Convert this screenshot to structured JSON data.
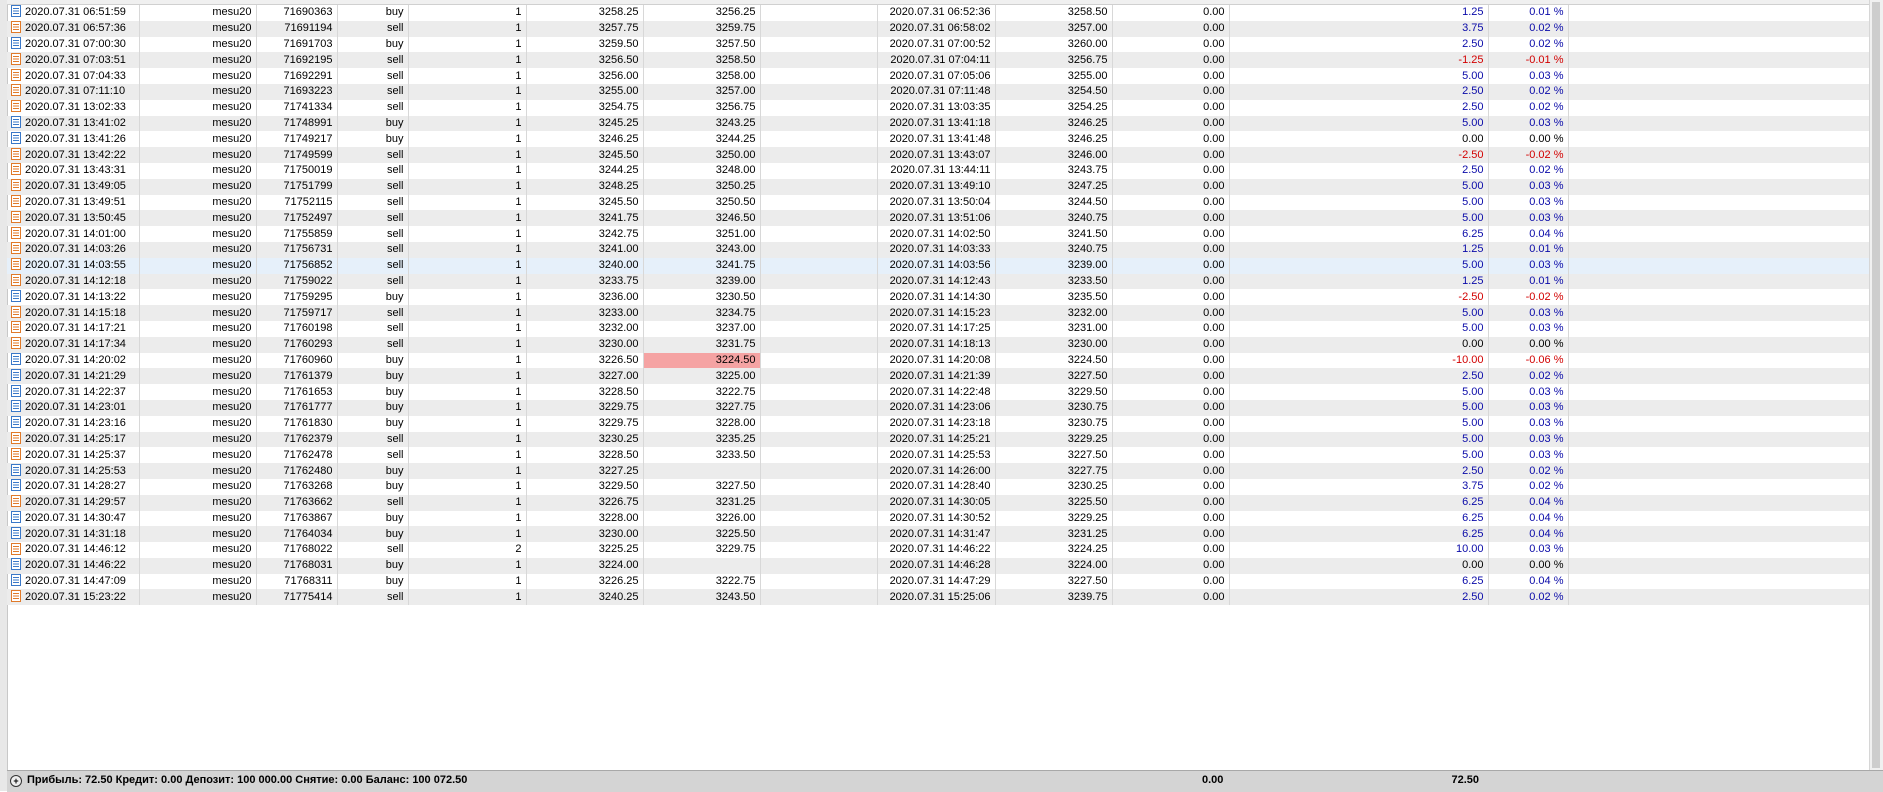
{
  "rows": [
    {
      "open_time": "2020.07.31 06:51:59",
      "symbol": "mesu20",
      "ticket": "71690363",
      "type": "buy",
      "volume": "1",
      "open_price": "3258.25",
      "sl": "3256.25",
      "tp": "",
      "close_time": "2020.07.31 06:52:36",
      "close_price": "3258.50",
      "swap": "0.00",
      "profit": "1.25",
      "pct": "0.01 %",
      "sign": "pos",
      "icon": "blue"
    },
    {
      "open_time": "2020.07.31 06:57:36",
      "symbol": "mesu20",
      "ticket": "71691194",
      "type": "sell",
      "volume": "1",
      "open_price": "3257.75",
      "sl": "3259.75",
      "tp": "",
      "close_time": "2020.07.31 06:58:02",
      "close_price": "3257.00",
      "swap": "0.00",
      "profit": "3.75",
      "pct": "0.02 %",
      "sign": "pos",
      "icon": "orange"
    },
    {
      "open_time": "2020.07.31 07:00:30",
      "symbol": "mesu20",
      "ticket": "71691703",
      "type": "buy",
      "volume": "1",
      "open_price": "3259.50",
      "sl": "3257.50",
      "tp": "",
      "close_time": "2020.07.31 07:00:52",
      "close_price": "3260.00",
      "swap": "0.00",
      "profit": "2.50",
      "pct": "0.02 %",
      "sign": "pos",
      "icon": "blue"
    },
    {
      "open_time": "2020.07.31 07:03:51",
      "symbol": "mesu20",
      "ticket": "71692195",
      "type": "sell",
      "volume": "1",
      "open_price": "3256.50",
      "sl": "3258.50",
      "tp": "",
      "close_time": "2020.07.31 07:04:11",
      "close_price": "3256.75",
      "swap": "0.00",
      "profit": "-1.25",
      "pct": "-0.01 %",
      "sign": "neg",
      "icon": "orange"
    },
    {
      "open_time": "2020.07.31 07:04:33",
      "symbol": "mesu20",
      "ticket": "71692291",
      "type": "sell",
      "volume": "1",
      "open_price": "3256.00",
      "sl": "3258.00",
      "tp": "",
      "close_time": "2020.07.31 07:05:06",
      "close_price": "3255.00",
      "swap": "0.00",
      "profit": "5.00",
      "pct": "0.03 %",
      "sign": "pos",
      "icon": "orange"
    },
    {
      "open_time": "2020.07.31 07:11:10",
      "symbol": "mesu20",
      "ticket": "71693223",
      "type": "sell",
      "volume": "1",
      "open_price": "3255.00",
      "sl": "3257.00",
      "tp": "",
      "close_time": "2020.07.31 07:11:48",
      "close_price": "3254.50",
      "swap": "0.00",
      "profit": "2.50",
      "pct": "0.02 %",
      "sign": "pos",
      "icon": "orange"
    },
    {
      "open_time": "2020.07.31 13:02:33",
      "symbol": "mesu20",
      "ticket": "71741334",
      "type": "sell",
      "volume": "1",
      "open_price": "3254.75",
      "sl": "3256.75",
      "tp": "",
      "close_time": "2020.07.31 13:03:35",
      "close_price": "3254.25",
      "swap": "0.00",
      "profit": "2.50",
      "pct": "0.02 %",
      "sign": "pos",
      "icon": "orange"
    },
    {
      "open_time": "2020.07.31 13:41:02",
      "symbol": "mesu20",
      "ticket": "71748991",
      "type": "buy",
      "volume": "1",
      "open_price": "3245.25",
      "sl": "3243.25",
      "tp": "",
      "close_time": "2020.07.31 13:41:18",
      "close_price": "3246.25",
      "swap": "0.00",
      "profit": "5.00",
      "pct": "0.03 %",
      "sign": "pos",
      "icon": "blue"
    },
    {
      "open_time": "2020.07.31 13:41:26",
      "symbol": "mesu20",
      "ticket": "71749217",
      "type": "buy",
      "volume": "1",
      "open_price": "3246.25",
      "sl": "3244.25",
      "tp": "",
      "close_time": "2020.07.31 13:41:48",
      "close_price": "3246.25",
      "swap": "0.00",
      "profit": "0.00",
      "pct": "0.00 %",
      "sign": "zero",
      "icon": "blue"
    },
    {
      "open_time": "2020.07.31 13:42:22",
      "symbol": "mesu20",
      "ticket": "71749599",
      "type": "sell",
      "volume": "1",
      "open_price": "3245.50",
      "sl": "3250.00",
      "tp": "",
      "close_time": "2020.07.31 13:43:07",
      "close_price": "3246.00",
      "swap": "0.00",
      "profit": "-2.50",
      "pct": "-0.02 %",
      "sign": "neg",
      "icon": "orange"
    },
    {
      "open_time": "2020.07.31 13:43:31",
      "symbol": "mesu20",
      "ticket": "71750019",
      "type": "sell",
      "volume": "1",
      "open_price": "3244.25",
      "sl": "3248.00",
      "tp": "",
      "close_time": "2020.07.31 13:44:11",
      "close_price": "3243.75",
      "swap": "0.00",
      "profit": "2.50",
      "pct": "0.02 %",
      "sign": "pos",
      "icon": "orange"
    },
    {
      "open_time": "2020.07.31 13:49:05",
      "symbol": "mesu20",
      "ticket": "71751799",
      "type": "sell",
      "volume": "1",
      "open_price": "3248.25",
      "sl": "3250.25",
      "tp": "",
      "close_time": "2020.07.31 13:49:10",
      "close_price": "3247.25",
      "swap": "0.00",
      "profit": "5.00",
      "pct": "0.03 %",
      "sign": "pos",
      "icon": "orange"
    },
    {
      "open_time": "2020.07.31 13:49:51",
      "symbol": "mesu20",
      "ticket": "71752115",
      "type": "sell",
      "volume": "1",
      "open_price": "3245.50",
      "sl": "3250.50",
      "tp": "",
      "close_time": "2020.07.31 13:50:04",
      "close_price": "3244.50",
      "swap": "0.00",
      "profit": "5.00",
      "pct": "0.03 %",
      "sign": "pos",
      "icon": "orange"
    },
    {
      "open_time": "2020.07.31 13:50:45",
      "symbol": "mesu20",
      "ticket": "71752497",
      "type": "sell",
      "volume": "1",
      "open_price": "3241.75",
      "sl": "3246.50",
      "tp": "",
      "close_time": "2020.07.31 13:51:06",
      "close_price": "3240.75",
      "swap": "0.00",
      "profit": "5.00",
      "pct": "0.03 %",
      "sign": "pos",
      "icon": "orange"
    },
    {
      "open_time": "2020.07.31 14:01:00",
      "symbol": "mesu20",
      "ticket": "71755859",
      "type": "sell",
      "volume": "1",
      "open_price": "3242.75",
      "sl": "3251.00",
      "tp": "",
      "close_time": "2020.07.31 14:02:50",
      "close_price": "3241.50",
      "swap": "0.00",
      "profit": "6.25",
      "pct": "0.04 %",
      "sign": "pos",
      "icon": "orange"
    },
    {
      "open_time": "2020.07.31 14:03:26",
      "symbol": "mesu20",
      "ticket": "71756731",
      "type": "sell",
      "volume": "1",
      "open_price": "3241.00",
      "sl": "3243.00",
      "tp": "",
      "close_time": "2020.07.31 14:03:33",
      "close_price": "3240.75",
      "swap": "0.00",
      "profit": "1.25",
      "pct": "0.01 %",
      "sign": "pos",
      "icon": "orange"
    },
    {
      "open_time": "2020.07.31 14:03:55",
      "symbol": "mesu20",
      "ticket": "71756852",
      "type": "sell",
      "volume": "1",
      "open_price": "3240.00",
      "sl": "3241.75",
      "tp": "",
      "close_time": "2020.07.31 14:03:56",
      "close_price": "3239.00",
      "swap": "0.00",
      "profit": "5.00",
      "pct": "0.03 %",
      "sign": "pos",
      "icon": "orange"
    },
    {
      "open_time": "2020.07.31 14:12:18",
      "symbol": "mesu20",
      "ticket": "71759022",
      "type": "sell",
      "volume": "1",
      "open_price": "3233.75",
      "sl": "3239.00",
      "tp": "",
      "close_time": "2020.07.31 14:12:43",
      "close_price": "3233.50",
      "swap": "0.00",
      "profit": "1.25",
      "pct": "0.01 %",
      "sign": "pos",
      "icon": "orange"
    },
    {
      "open_time": "2020.07.31 14:13:22",
      "symbol": "mesu20",
      "ticket": "71759295",
      "type": "buy",
      "volume": "1",
      "open_price": "3236.00",
      "sl": "3230.50",
      "tp": "",
      "close_time": "2020.07.31 14:14:30",
      "close_price": "3235.50",
      "swap": "0.00",
      "profit": "-2.50",
      "pct": "-0.02 %",
      "sign": "neg",
      "icon": "blue"
    },
    {
      "open_time": "2020.07.31 14:15:18",
      "symbol": "mesu20",
      "ticket": "71759717",
      "type": "sell",
      "volume": "1",
      "open_price": "3233.00",
      "sl": "3234.75",
      "tp": "",
      "close_time": "2020.07.31 14:15:23",
      "close_price": "3232.00",
      "swap": "0.00",
      "profit": "5.00",
      "pct": "0.03 %",
      "sign": "pos",
      "icon": "orange"
    },
    {
      "open_time": "2020.07.31 14:17:21",
      "symbol": "mesu20",
      "ticket": "71760198",
      "type": "sell",
      "volume": "1",
      "open_price": "3232.00",
      "sl": "3237.00",
      "tp": "",
      "close_time": "2020.07.31 14:17:25",
      "close_price": "3231.00",
      "swap": "0.00",
      "profit": "5.00",
      "pct": "0.03 %",
      "sign": "pos",
      "icon": "orange"
    },
    {
      "open_time": "2020.07.31 14:17:34",
      "symbol": "mesu20",
      "ticket": "71760293",
      "type": "sell",
      "volume": "1",
      "open_price": "3230.00",
      "sl": "3231.75",
      "tp": "",
      "close_time": "2020.07.31 14:18:13",
      "close_price": "3230.00",
      "swap": "0.00",
      "profit": "0.00",
      "pct": "0.00 %",
      "sign": "zero",
      "icon": "orange"
    },
    {
      "open_time": "2020.07.31 14:20:02",
      "symbol": "mesu20",
      "ticket": "71760960",
      "type": "buy",
      "volume": "1",
      "open_price": "3226.50",
      "sl": "3224.50",
      "tp": "",
      "close_time": "2020.07.31 14:20:08",
      "close_price": "3224.50",
      "swap": "0.00",
      "profit": "-10.00",
      "pct": "-0.06 %",
      "sign": "neg",
      "icon": "blue",
      "sl_hit": true
    },
    {
      "open_time": "2020.07.31 14:21:29",
      "symbol": "mesu20",
      "ticket": "71761379",
      "type": "buy",
      "volume": "1",
      "open_price": "3227.00",
      "sl": "3225.00",
      "tp": "",
      "close_time": "2020.07.31 14:21:39",
      "close_price": "3227.50",
      "swap": "0.00",
      "profit": "2.50",
      "pct": "0.02 %",
      "sign": "pos",
      "icon": "blue"
    },
    {
      "open_time": "2020.07.31 14:22:37",
      "symbol": "mesu20",
      "ticket": "71761653",
      "type": "buy",
      "volume": "1",
      "open_price": "3228.50",
      "sl": "3222.75",
      "tp": "",
      "close_time": "2020.07.31 14:22:48",
      "close_price": "3229.50",
      "swap": "0.00",
      "profit": "5.00",
      "pct": "0.03 %",
      "sign": "pos",
      "icon": "blue"
    },
    {
      "open_time": "2020.07.31 14:23:01",
      "symbol": "mesu20",
      "ticket": "71761777",
      "type": "buy",
      "volume": "1",
      "open_price": "3229.75",
      "sl": "3227.75",
      "tp": "",
      "close_time": "2020.07.31 14:23:06",
      "close_price": "3230.75",
      "swap": "0.00",
      "profit": "5.00",
      "pct": "0.03 %",
      "sign": "pos",
      "icon": "blue"
    },
    {
      "open_time": "2020.07.31 14:23:16",
      "symbol": "mesu20",
      "ticket": "71761830",
      "type": "buy",
      "volume": "1",
      "open_price": "3229.75",
      "sl": "3228.00",
      "tp": "",
      "close_time": "2020.07.31 14:23:18",
      "close_price": "3230.75",
      "swap": "0.00",
      "profit": "5.00",
      "pct": "0.03 %",
      "sign": "pos",
      "icon": "blue"
    },
    {
      "open_time": "2020.07.31 14:25:17",
      "symbol": "mesu20",
      "ticket": "71762379",
      "type": "sell",
      "volume": "1",
      "open_price": "3230.25",
      "sl": "3235.25",
      "tp": "",
      "close_time": "2020.07.31 14:25:21",
      "close_price": "3229.25",
      "swap": "0.00",
      "profit": "5.00",
      "pct": "0.03 %",
      "sign": "pos",
      "icon": "orange"
    },
    {
      "open_time": "2020.07.31 14:25:37",
      "symbol": "mesu20",
      "ticket": "71762478",
      "type": "sell",
      "volume": "1",
      "open_price": "3228.50",
      "sl": "3233.50",
      "tp": "",
      "close_time": "2020.07.31 14:25:53",
      "close_price": "3227.50",
      "swap": "0.00",
      "profit": "5.00",
      "pct": "0.03 %",
      "sign": "pos",
      "icon": "orange"
    },
    {
      "open_time": "2020.07.31 14:25:53",
      "symbol": "mesu20",
      "ticket": "71762480",
      "type": "buy",
      "volume": "1",
      "open_price": "3227.25",
      "sl": "",
      "tp": "",
      "close_time": "2020.07.31 14:26:00",
      "close_price": "3227.75",
      "swap": "0.00",
      "profit": "2.50",
      "pct": "0.02 %",
      "sign": "pos",
      "icon": "blue"
    },
    {
      "open_time": "2020.07.31 14:28:27",
      "symbol": "mesu20",
      "ticket": "71763268",
      "type": "buy",
      "volume": "1",
      "open_price": "3229.50",
      "sl": "3227.50",
      "tp": "",
      "close_time": "2020.07.31 14:28:40",
      "close_price": "3230.25",
      "swap": "0.00",
      "profit": "3.75",
      "pct": "0.02 %",
      "sign": "pos",
      "icon": "blue"
    },
    {
      "open_time": "2020.07.31 14:29:57",
      "symbol": "mesu20",
      "ticket": "71763662",
      "type": "sell",
      "volume": "1",
      "open_price": "3226.75",
      "sl": "3231.25",
      "tp": "",
      "close_time": "2020.07.31 14:30:05",
      "close_price": "3225.50",
      "swap": "0.00",
      "profit": "6.25",
      "pct": "0.04 %",
      "sign": "pos",
      "icon": "orange"
    },
    {
      "open_time": "2020.07.31 14:30:47",
      "symbol": "mesu20",
      "ticket": "71763867",
      "type": "buy",
      "volume": "1",
      "open_price": "3228.00",
      "sl": "3226.00",
      "tp": "",
      "close_time": "2020.07.31 14:30:52",
      "close_price": "3229.25",
      "swap": "0.00",
      "profit": "6.25",
      "pct": "0.04 %",
      "sign": "pos",
      "icon": "blue"
    },
    {
      "open_time": "2020.07.31 14:31:18",
      "symbol": "mesu20",
      "ticket": "71764034",
      "type": "buy",
      "volume": "1",
      "open_price": "3230.00",
      "sl": "3225.50",
      "tp": "",
      "close_time": "2020.07.31 14:31:47",
      "close_price": "3231.25",
      "swap": "0.00",
      "profit": "6.25",
      "pct": "0.04 %",
      "sign": "pos",
      "icon": "blue"
    },
    {
      "open_time": "2020.07.31 14:46:12",
      "symbol": "mesu20",
      "ticket": "71768022",
      "type": "sell",
      "volume": "2",
      "open_price": "3225.25",
      "sl": "3229.75",
      "tp": "",
      "close_time": "2020.07.31 14:46:22",
      "close_price": "3224.25",
      "swap": "0.00",
      "profit": "10.00",
      "pct": "0.03 %",
      "sign": "pos",
      "icon": "orange"
    },
    {
      "open_time": "2020.07.31 14:46:22",
      "symbol": "mesu20",
      "ticket": "71768031",
      "type": "buy",
      "volume": "1",
      "open_price": "3224.00",
      "sl": "",
      "tp": "",
      "close_time": "2020.07.31 14:46:28",
      "close_price": "3224.00",
      "swap": "0.00",
      "profit": "0.00",
      "pct": "0.00 %",
      "sign": "zero",
      "icon": "blue"
    },
    {
      "open_time": "2020.07.31 14:47:09",
      "symbol": "mesu20",
      "ticket": "71768311",
      "type": "buy",
      "volume": "1",
      "open_price": "3226.25",
      "sl": "3222.75",
      "tp": "",
      "close_time": "2020.07.31 14:47:29",
      "close_price": "3227.50",
      "swap": "0.00",
      "profit": "6.25",
      "pct": "0.04 %",
      "sign": "pos",
      "icon": "blue"
    },
    {
      "open_time": "2020.07.31 15:23:22",
      "symbol": "mesu20",
      "ticket": "71775414",
      "type": "sell",
      "volume": "1",
      "open_price": "3240.25",
      "sl": "3243.50",
      "tp": "",
      "close_time": "2020.07.31 15:25:06",
      "close_price": "3239.75",
      "swap": "0.00",
      "profit": "2.50",
      "pct": "0.02 %",
      "sign": "pos",
      "icon": "orange"
    }
  ],
  "status": {
    "summary": "Прибыль: 72.50  Кредит: 0.00  Депозит: 100 000.00  Снятие: 0.00  Баланс: 100 072.50",
    "swap_total": "0.00",
    "profit_total": "72.50"
  },
  "colors": {
    "positive": "#0a0aa8",
    "negative": "#d20000",
    "sl_hit": "#f5a3a3",
    "buy_icon": "#3a78c8",
    "sell_icon": "#e07a2a"
  },
  "icons": {
    "row_buy": "doc-blue-icon",
    "row_sell": "doc-orange-icon",
    "status": "expand-circle-icon"
  }
}
